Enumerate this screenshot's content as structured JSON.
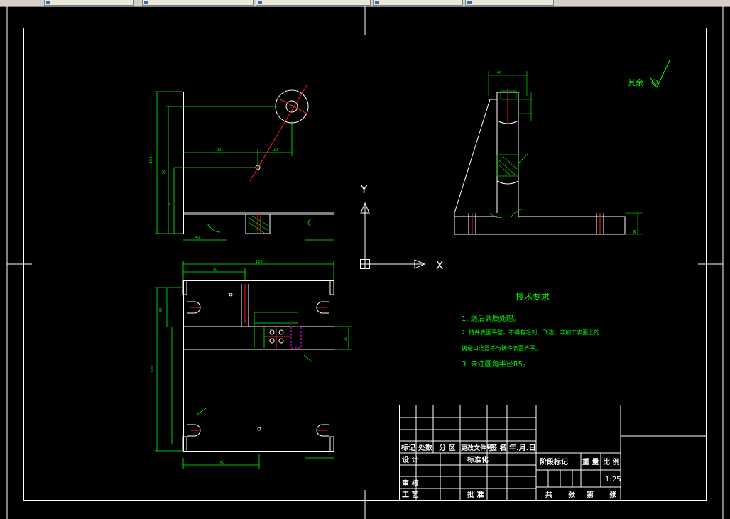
{
  "app": {
    "tabs": [
      {
        "label": "",
        "icon": "drawing-file-icon"
      },
      {
        "label": "",
        "icon": "drawing-file-icon"
      },
      {
        "label": "",
        "icon": "drawing-file-icon"
      },
      {
        "label": "",
        "icon": "drawing-file-icon"
      },
      {
        "label": "",
        "icon": "drawing-file-icon"
      }
    ]
  },
  "drawing": {
    "ucs": {
      "y_label": "Y",
      "x_label": "X"
    },
    "surface_finish": {
      "label": "其余"
    },
    "tech_requirements": {
      "title": "技术要求",
      "items": [
        "1. 退后调质处理。",
        "2. 铸件表面平整，不得有毛刺、飞边，非加工表面上的",
        "   铸造口浇冒等与铸件表面齐平。",
        "3. 未注圆角半径R5。"
      ]
    },
    "title_block": {
      "header": [
        "标记",
        "处数",
        "分 区",
        "更改文件号",
        "签 名",
        "年.月.日"
      ],
      "rows": [
        "设 计",
        "审 核",
        "工 艺"
      ],
      "std_label": "标准化",
      "approve_label": "批 准",
      "stage_header": [
        "阶段标记",
        "重 量",
        "比 例"
      ],
      "scale": "1:25",
      "sheet": [
        "共",
        "张",
        "第",
        "张"
      ]
    },
    "dims": {
      "front_view": [
        "150",
        "50",
        "20",
        "30",
        "20",
        "40"
      ],
      "bottom_view": [
        "150",
        "50",
        "40",
        "120",
        "60",
        "20"
      ],
      "side_view": [
        "30",
        "40"
      ]
    },
    "colors": {
      "border": "#ffffff",
      "dimension": "#00ff00",
      "geometry": "#ffffff",
      "centerline": "#ff0000",
      "hidden": "#ff00ff",
      "text": "#00ff00"
    }
  }
}
